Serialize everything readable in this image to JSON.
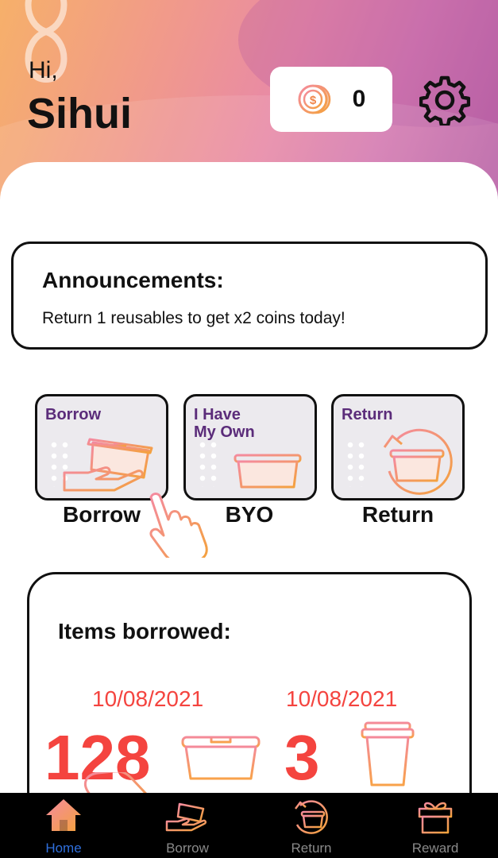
{
  "greeting": {
    "hi": "Hi,",
    "name": "Sihui"
  },
  "coins": {
    "value": "0",
    "icon": "coin-icon"
  },
  "announcement": {
    "title": "Announcements:",
    "text": "Return 1 reusables to get x2 coins today!"
  },
  "actions": [
    {
      "tile_title": "Borrow",
      "label": "Borrow",
      "icon": "borrow-box-icon"
    },
    {
      "tile_title_line1": "I Have",
      "tile_title_line2": "My Own",
      "label": "BYO",
      "icon": "byo-box-icon"
    },
    {
      "tile_title": "Return",
      "label": "Return",
      "icon": "return-box-icon"
    }
  ],
  "borrowed": {
    "title": "Items borrowed:",
    "items": [
      {
        "date": "10/08/2021",
        "count": "128",
        "icon": "container-icon"
      },
      {
        "date": "10/08/2021",
        "count": "3",
        "icon": "cup-icon"
      }
    ]
  },
  "tabs": [
    {
      "label": "Home",
      "icon": "home-icon",
      "active": true
    },
    {
      "label": "Borrow",
      "icon": "borrow-icon",
      "active": false
    },
    {
      "label": "Return",
      "icon": "return-icon",
      "active": false
    },
    {
      "label": "Reward",
      "icon": "gift-icon",
      "active": false
    }
  ],
  "colors": {
    "accent_red": "#f4443f",
    "tile_text": "#5b2c7a",
    "active_tab": "#2f6fdc",
    "inactive_tab": "#8a8a8a"
  }
}
